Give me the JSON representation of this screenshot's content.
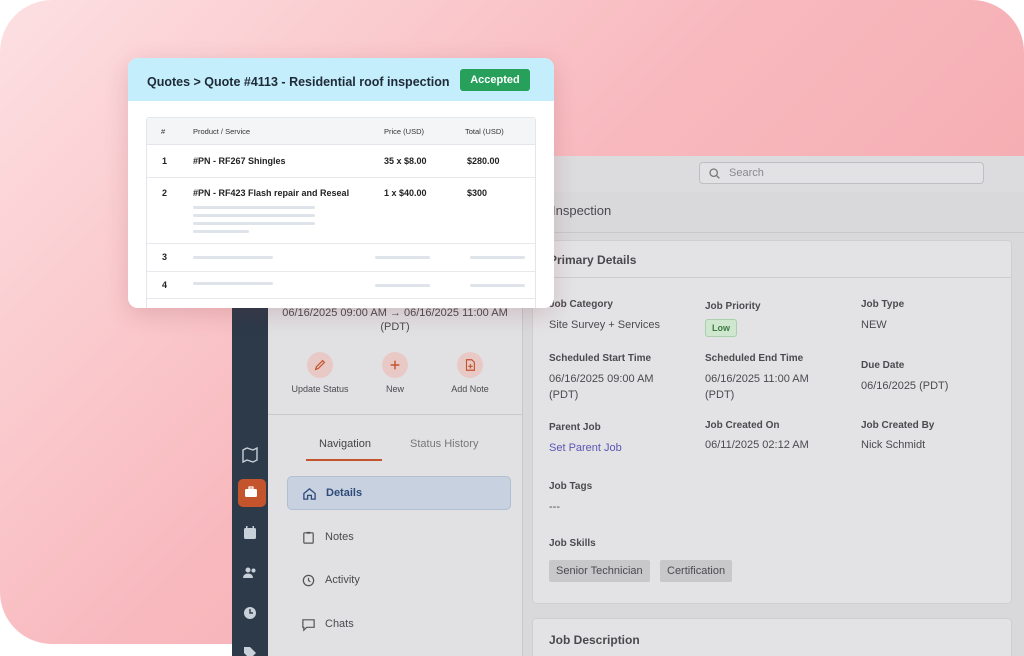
{
  "search": {
    "placeholder": "Search"
  },
  "page": {
    "title": "Inspection"
  },
  "left_panel": {
    "datetime": "06/16/2025 09:00 AM → 06/16/2025 11:00 AM",
    "datetime_tz": "(PDT)",
    "actions": [
      {
        "label": "Update Status",
        "icon": "pencil-icon"
      },
      {
        "label": "New",
        "icon": "plus-icon"
      },
      {
        "label": "Add Note",
        "icon": "file-plus-icon"
      }
    ],
    "tabs": [
      "Navigation",
      "Status History"
    ],
    "nav": [
      {
        "label": "Details",
        "icon": "home-icon",
        "active": true
      },
      {
        "label": "Notes",
        "icon": "clipboard-icon"
      },
      {
        "label": "Activity",
        "icon": "history-icon"
      },
      {
        "label": "Chats",
        "icon": "chat-icon"
      }
    ]
  },
  "primary": {
    "title": "Primary Details",
    "job_category_label": "Job Category",
    "job_category": "Site Survey + Services",
    "job_priority_label": "Job Priority",
    "job_priority": "Low",
    "job_type_label": "Job Type",
    "job_type": "NEW",
    "sched_start_label": "Scheduled Start Time",
    "sched_start_1": "06/16/2025 09:00 AM",
    "sched_start_2": "(PDT)",
    "sched_end_label": "Scheduled End Time",
    "sched_end_1": "06/16/2025 11:00 AM",
    "sched_end_2": "(PDT)",
    "due_date_label": "Due Date",
    "due_date": "06/16/2025 (PDT)",
    "parent_job_label": "Parent Job",
    "parent_job": "Set Parent Job",
    "created_on_label": "Job Created On",
    "created_on": "06/11/2025 02:12 AM",
    "created_by_label": "Job Created By",
    "created_by": "Nick Schmidt",
    "tags_label": "Job Tags",
    "tags": "---",
    "skills_label": "Job Skills",
    "skills": [
      "Senior Technician",
      "Certification"
    ]
  },
  "job_description": {
    "title": "Job Description"
  },
  "quote": {
    "title": "Quotes > Quote #4113 - Residential roof inspection",
    "status": "Accepted",
    "columns": [
      "#",
      "Product / Service",
      "Price (USD)",
      "Total (USD)"
    ],
    "rows": [
      {
        "num": "1",
        "item": "#PN - RF267 Shingles",
        "price": "35 x $8.00",
        "total": "$280.00"
      },
      {
        "num": "2",
        "item": "#PN - RF423 Flash repair and Reseal",
        "price": "1 x $40.00",
        "total": "$300"
      },
      {
        "num": "3"
      },
      {
        "num": "4"
      }
    ]
  },
  "colors": {
    "accent": "#c4542c",
    "accepted": "#26a05a",
    "quote_header": "#c4eefb"
  }
}
